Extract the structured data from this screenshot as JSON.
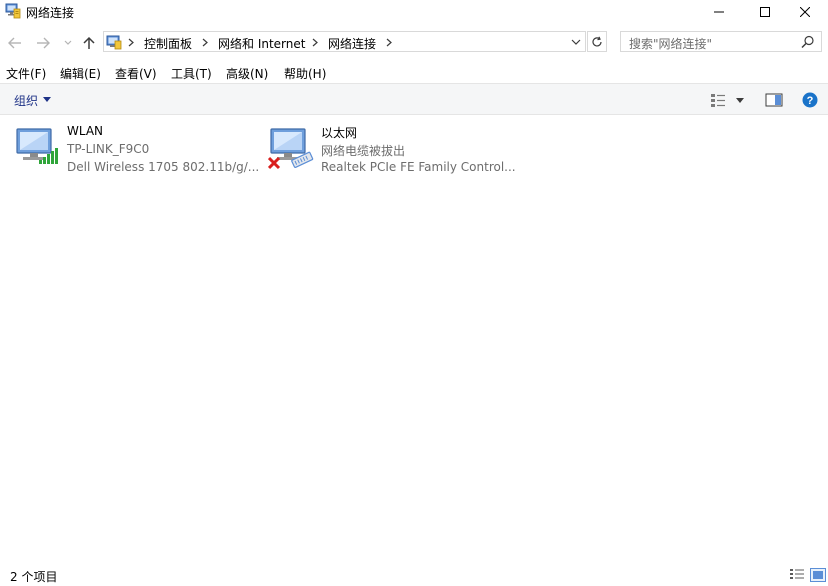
{
  "window": {
    "title": "网络连接"
  },
  "nav": {
    "breadcrumbs": [
      "控制面板",
      "网络和 Internet",
      "网络连接"
    ],
    "search_placeholder": "搜索\"网络连接\""
  },
  "menu": [
    "文件(F)",
    "编辑(E)",
    "查看(V)",
    "工具(T)",
    "高级(N)",
    "帮助(H)"
  ],
  "command_bar": {
    "organize_label": "组织"
  },
  "connections": [
    {
      "name": "WLAN",
      "status": "TP-LINK_F9C0",
      "adapter": "Dell Wireless 1705 802.11b/g/...",
      "type": "wireless-network-icon"
    },
    {
      "name": "以太网",
      "status": "网络电缆被拔出",
      "adapter": "Realtek PCIe FE Family Control...",
      "type": "ethernet-disconnected-icon"
    }
  ],
  "status_bar": {
    "item_count": "2 个项目"
  },
  "colors": {
    "accent": "#1e3287",
    "help_blue": "#1a73c9",
    "signal_green": "#2fa53a",
    "error_red": "#d9201f"
  }
}
